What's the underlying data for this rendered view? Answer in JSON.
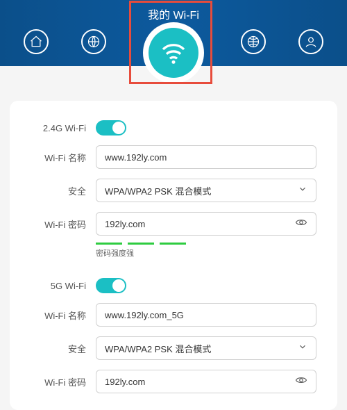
{
  "header": {
    "title": "我的 Wi-Fi"
  },
  "band24": {
    "section_label": "2.4G Wi-Fi",
    "name_label": "Wi-Fi 名称",
    "name_value": "www.192ly.com",
    "security_label": "安全",
    "security_value": "WPA/WPA2 PSK 混合模式",
    "password_label": "Wi-Fi 密码",
    "password_value": "192ly.com",
    "strength_label": "密码强度强"
  },
  "band5": {
    "section_label": "5G Wi-Fi",
    "name_label": "Wi-Fi 名称",
    "name_value": "www.192ly.com_5G",
    "security_label": "安全",
    "security_value": "WPA/WPA2 PSK 混合模式",
    "password_label": "Wi-Fi 密码",
    "password_value": "192ly.com"
  }
}
